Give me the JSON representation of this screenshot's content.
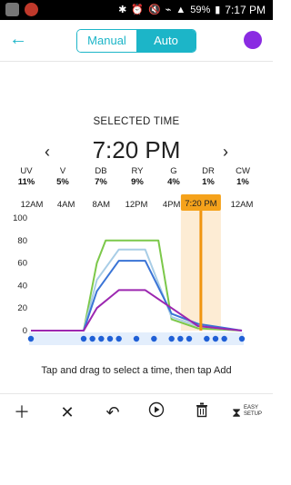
{
  "status": {
    "battery": "59%",
    "time": "7:17 PM"
  },
  "header": {
    "toggle": {
      "manual": "Manual",
      "auto": "Auto"
    }
  },
  "selected_time": {
    "label": "SELECTED TIME",
    "value": "7:20 PM"
  },
  "channels": [
    {
      "name": "UV",
      "value": "11%"
    },
    {
      "name": "V",
      "value": "5%"
    },
    {
      "name": "DB",
      "value": "7%"
    },
    {
      "name": "RY",
      "value": "9%"
    },
    {
      "name": "G",
      "value": "4%"
    },
    {
      "name": "DR",
      "value": "1%"
    },
    {
      "name": "CW",
      "value": "1%"
    }
  ],
  "chart_data": {
    "type": "line",
    "x_ticks": [
      "12AM",
      "4AM",
      "8AM",
      "12PM",
      "4PM",
      "12AM"
    ],
    "selected_marker": "7:20 PM",
    "ylim": [
      0,
      100
    ],
    "y_ticks": [
      0,
      20,
      40,
      60,
      80,
      100
    ],
    "series": [
      {
        "color": "#7cc84a",
        "points": [
          [
            0,
            0
          ],
          [
            6,
            0
          ],
          [
            7.5,
            60
          ],
          [
            8.5,
            80
          ],
          [
            14.5,
            80
          ],
          [
            16,
            10
          ],
          [
            19,
            2
          ],
          [
            24,
            0
          ]
        ]
      },
      {
        "color": "#a8cde6",
        "points": [
          [
            0,
            0
          ],
          [
            6,
            0
          ],
          [
            7.5,
            45
          ],
          [
            10,
            72
          ],
          [
            13,
            72
          ],
          [
            16,
            12
          ],
          [
            19,
            4
          ],
          [
            24,
            0
          ]
        ]
      },
      {
        "color": "#3a74d6",
        "points": [
          [
            0,
            0
          ],
          [
            6,
            0
          ],
          [
            7.5,
            35
          ],
          [
            10,
            62
          ],
          [
            13,
            62
          ],
          [
            16,
            15
          ],
          [
            19,
            6
          ],
          [
            24,
            0
          ]
        ]
      },
      {
        "color": "#9c27b0",
        "points": [
          [
            0,
            0
          ],
          [
            6,
            0
          ],
          [
            7.5,
            20
          ],
          [
            10,
            36
          ],
          [
            13,
            36
          ],
          [
            16,
            20
          ],
          [
            19,
            4
          ],
          [
            24,
            0
          ]
        ]
      }
    ],
    "points_color": "#1f5fd6"
  },
  "hint": "Tap and drag to select a time, then tap Add",
  "toolbar": {
    "easy_setup_1": "EASY",
    "easy_setup_2": "SETUP"
  }
}
